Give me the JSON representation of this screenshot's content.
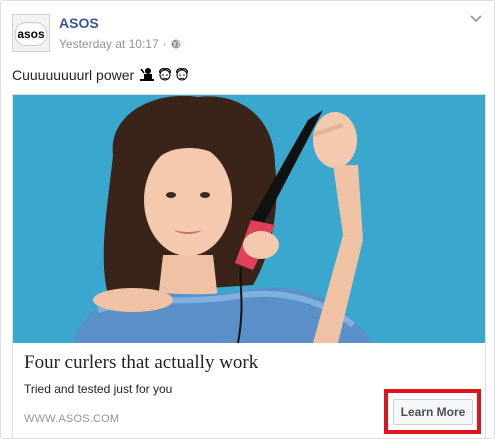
{
  "post": {
    "page_name": "ASOS",
    "timestamp": "Yesterday at 10:17",
    "separator": "·",
    "privacy_icon": "globe-icon",
    "options_icon": "chevron-down-icon",
    "text": "Cuuuuuuuurl power",
    "emojis": [
      "woman-getting-haircut-icon",
      "woman-with-curls-icon",
      "woman-with-curls-icon"
    ],
    "avatar_logo_text": "asos"
  },
  "link_card": {
    "headline": "Four curlers that actually work",
    "description": "Tried and tested just for you",
    "domain": "WWW.ASOS.COM",
    "cta_label": "Learn More"
  },
  "colors": {
    "page_name": "#365899",
    "meta": "#90949c",
    "image_bg": "#3aa7cf",
    "highlight": "#e0141e"
  }
}
